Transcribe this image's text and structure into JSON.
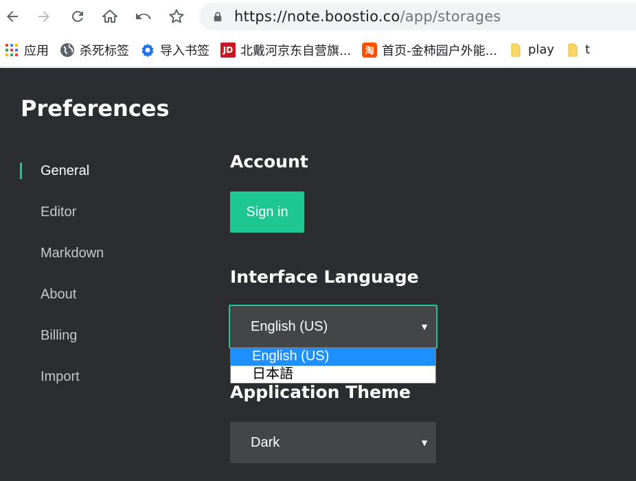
{
  "browser": {
    "url_host": "https://note.boostio.co",
    "url_path": "/app/storages"
  },
  "bookmarks": [
    {
      "label": "应用",
      "icon": "apps-grid-icon"
    },
    {
      "label": "杀死标签",
      "icon": "globe-icon"
    },
    {
      "label": "导入书签",
      "icon": "gear-icon"
    },
    {
      "label": "北戴河京东自营旗...",
      "icon": "jd-icon",
      "icon_text": "JD"
    },
    {
      "label": "首页-金柿园户外能...",
      "icon": "taobao-icon",
      "icon_text": "淘"
    },
    {
      "label": "play",
      "icon": "folder-icon"
    },
    {
      "label": "t",
      "icon": "folder-icon"
    }
  ],
  "app": {
    "title": "Preferences",
    "nav": [
      {
        "label": "General",
        "active": true
      },
      {
        "label": "Editor",
        "active": false
      },
      {
        "label": "Markdown",
        "active": false
      },
      {
        "label": "About",
        "active": false
      },
      {
        "label": "Billing",
        "active": false
      },
      {
        "label": "Import",
        "active": false
      }
    ],
    "account": {
      "heading": "Account",
      "signin_label": "Sign in"
    },
    "language": {
      "heading": "Interface Language",
      "selected": "English (US)",
      "options": [
        "English (US)",
        "日本語"
      ]
    },
    "theme": {
      "heading": "Application Theme",
      "selected": "Dark"
    },
    "colors": {
      "accent": "#1ec78f",
      "background": "#2c2d30",
      "select_bg": "#444547",
      "dropdown_highlight": "#1e90ff"
    }
  }
}
